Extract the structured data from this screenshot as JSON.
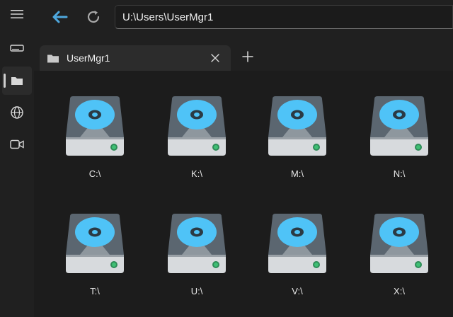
{
  "toolbar": {
    "menu_icon": "hamburger-menu-icon",
    "back_icon": "back-arrow-icon",
    "refresh_icon": "refresh-icon",
    "address_value": "U:\\Users\\UserMgr1"
  },
  "sidebar": {
    "items": [
      {
        "name": "drives",
        "icon": "drive-icon",
        "active": false
      },
      {
        "name": "files",
        "icon": "folder-icon",
        "active": true
      },
      {
        "name": "network",
        "icon": "globe-icon",
        "active": false
      },
      {
        "name": "video",
        "icon": "video-camera-icon",
        "active": false
      }
    ]
  },
  "tabs": [
    {
      "label": "UserMgr1",
      "icon": "folder-icon",
      "close_icon": "close-icon"
    }
  ],
  "new_tab_icon": "plus-icon",
  "drives": [
    {
      "label": "C:\\"
    },
    {
      "label": "K:\\"
    },
    {
      "label": "M:\\"
    },
    {
      "label": "N:\\"
    },
    {
      "label": "T:\\"
    },
    {
      "label": "U:\\"
    },
    {
      "label": "V:\\"
    },
    {
      "label": "X:\\"
    }
  ],
  "colors": {
    "accent": "#4ea8de",
    "disc": "#4fc3f7",
    "drive_body": "#5b6670",
    "background": "#1c1c1c"
  }
}
